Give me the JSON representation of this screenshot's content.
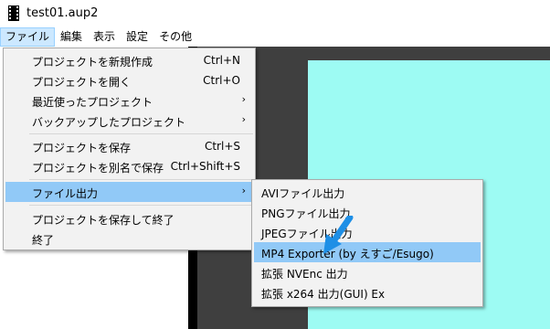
{
  "window": {
    "title": "test01.aup2",
    "icon": "film-icon"
  },
  "menubar": {
    "items": [
      "ファイル",
      "編集",
      "表示",
      "設定",
      "その他"
    ]
  },
  "file_menu": {
    "items": [
      {
        "label": "プロジェクトを新規作成",
        "shortcut": "Ctrl+N"
      },
      {
        "label": "プロジェクトを開く",
        "shortcut": "Ctrl+O"
      },
      {
        "label": "最近使ったプロジェクト",
        "arrow": "›"
      },
      {
        "label": "バックアップしたプロジェクト",
        "arrow": "›"
      },
      {
        "label": "プロジェクトを保存",
        "shortcut": "Ctrl+S"
      },
      {
        "label": "プロジェクトを別名で保存",
        "shortcut": "Ctrl+Shift+S"
      },
      {
        "label": "ファイル出力",
        "arrow": "›",
        "highlighted": true
      },
      {
        "label": "プロジェクトを保存して終了"
      },
      {
        "label": "終了"
      }
    ]
  },
  "export_submenu": {
    "items": [
      {
        "label": "AVIファイル出力"
      },
      {
        "label": "PNGファイル出力"
      },
      {
        "label": "JPEGファイル出力"
      },
      {
        "label": "MP4 Exporter (by えすご/Esugo)",
        "highlighted": true
      },
      {
        "label": "拡張 NVEnc 出力"
      },
      {
        "label": "拡張 x264 出力(GUI) Ex"
      }
    ]
  },
  "colors": {
    "highlight": "#91c9f7",
    "menu_bg": "#f2f2f2",
    "preview": "#9dfbf3",
    "arrow": "#1e8fe6"
  }
}
